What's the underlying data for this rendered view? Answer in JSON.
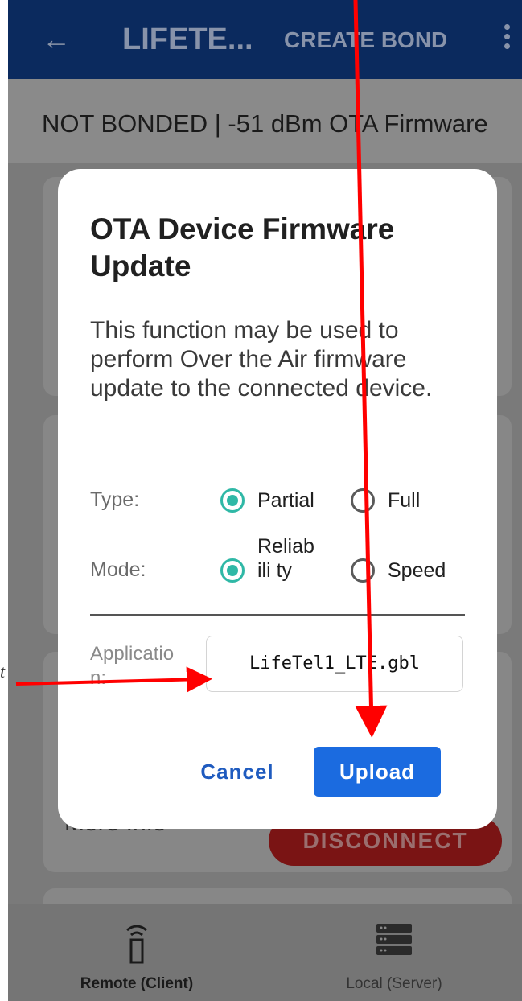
{
  "app_bar": {
    "back_icon": "arrow-left-icon",
    "title": "LIFETE...",
    "create_bond": "CREATE BOND",
    "menu_icon": "more-vert-icon"
  },
  "status": {
    "text": "NOT BONDED | -51 dBm OTA Firmware"
  },
  "background": {
    "more_info": "More Info",
    "disconnect": "DISCONNECT"
  },
  "dialog": {
    "title": "OTA Device Firmware Update",
    "description": "This function may be used to perform Over the Air firmware update to the connected device.",
    "type_label": "Type:",
    "type_options": [
      "Partial",
      "Full"
    ],
    "type_selected": "Partial",
    "mode_label": "Mode:",
    "mode_options": [
      "Reliability",
      "Speed"
    ],
    "mode_option_reliability_display": "Reliabili ty",
    "mode_selected": "Reliability",
    "application_label": "Applicatio n:",
    "application_file": "LifeTel1_LTE.gbl",
    "cancel": "Cancel",
    "upload": "Upload"
  },
  "bottom_nav": {
    "items": [
      {
        "label": "Remote (Client)",
        "icon": "remote-icon",
        "active": true
      },
      {
        "label": "Local (Server)",
        "icon": "server-icon",
        "active": false
      }
    ]
  },
  "annotation": {
    "left_marker": "t",
    "arrow_color": "#ff0000"
  },
  "colors": {
    "accent_teal": "#2fb8a6",
    "primary_blue": "#1b6be0",
    "appbar": "#0b2a5e"
  }
}
